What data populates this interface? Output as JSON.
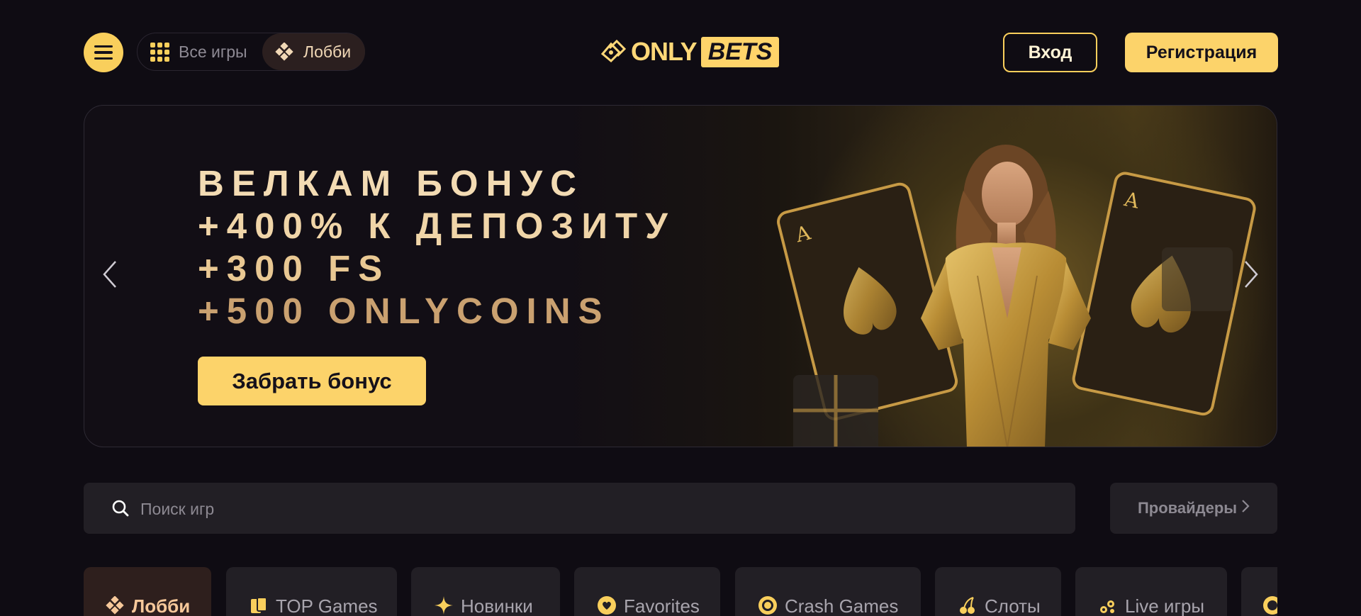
{
  "header": {
    "menu_icon": "hamburger-icon",
    "nav": {
      "all_games": "Все игры",
      "lobby": "Лобби"
    },
    "logo": {
      "only": "ONLY",
      "bets": "BETS"
    },
    "login_label": "Вход",
    "register_label": "Регистрация"
  },
  "banner": {
    "line1": "ВЕЛКАМ БОНУС",
    "line2": "+400% К ДЕПОЗИТУ",
    "line3": "+300 FS",
    "line4": "+500 ONLYCOINS",
    "cta_label": "Забрать бонус"
  },
  "search": {
    "placeholder": "Поиск игр"
  },
  "providers_label": "Провайдеры",
  "categories": [
    {
      "label": "Лобби",
      "icon": "clover-icon"
    },
    {
      "label": "TOP Games",
      "icon": "cards-icon"
    },
    {
      "label": "Новинки",
      "icon": "sparkle-icon"
    },
    {
      "label": "Favorites",
      "icon": "heart-icon"
    },
    {
      "label": "Crash Games",
      "icon": "chip-icon"
    },
    {
      "label": "Слоты",
      "icon": "cherry-icon"
    },
    {
      "label": "Live игры",
      "icon": "live-icon"
    }
  ],
  "colors": {
    "accent": "#fcd36a",
    "background": "#0f0c13",
    "panel": "#221f25"
  }
}
